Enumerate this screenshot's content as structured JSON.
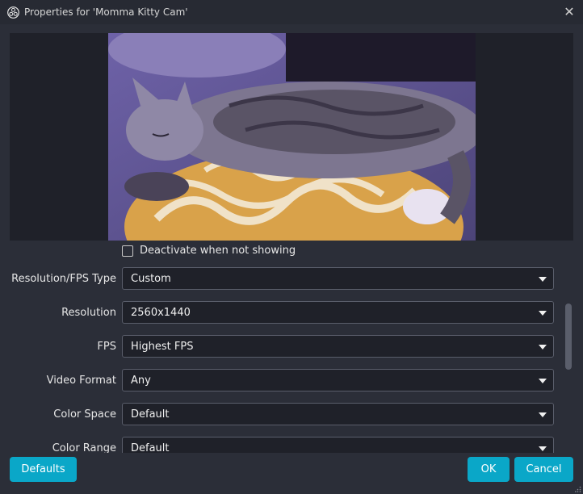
{
  "window": {
    "title": "Properties for 'Momma Kitty Cam'",
    "app_icon": "obs-logo-icon",
    "close_icon": "close-icon",
    "close_glyph": "✕"
  },
  "preview": {
    "description_icon": "webcam-preview-image"
  },
  "properties": {
    "deactivate_checkbox": {
      "label": "Deactivate when not showing",
      "checked": false
    },
    "rows": [
      {
        "label": "Resolution/FPS Type",
        "value": "Custom"
      },
      {
        "label": "Resolution",
        "value": "2560x1440"
      },
      {
        "label": "FPS",
        "value": "Highest FPS"
      },
      {
        "label": "Video Format",
        "value": "Any"
      },
      {
        "label": "Color Space",
        "value": "Default"
      },
      {
        "label": "Color Range",
        "value": "Default"
      }
    ]
  },
  "buttons": {
    "defaults": "Defaults",
    "ok": "OK",
    "cancel": "Cancel"
  },
  "colors": {
    "accent": "#0aa7c8",
    "background": "#2b2e38",
    "field": "#1f2129"
  }
}
